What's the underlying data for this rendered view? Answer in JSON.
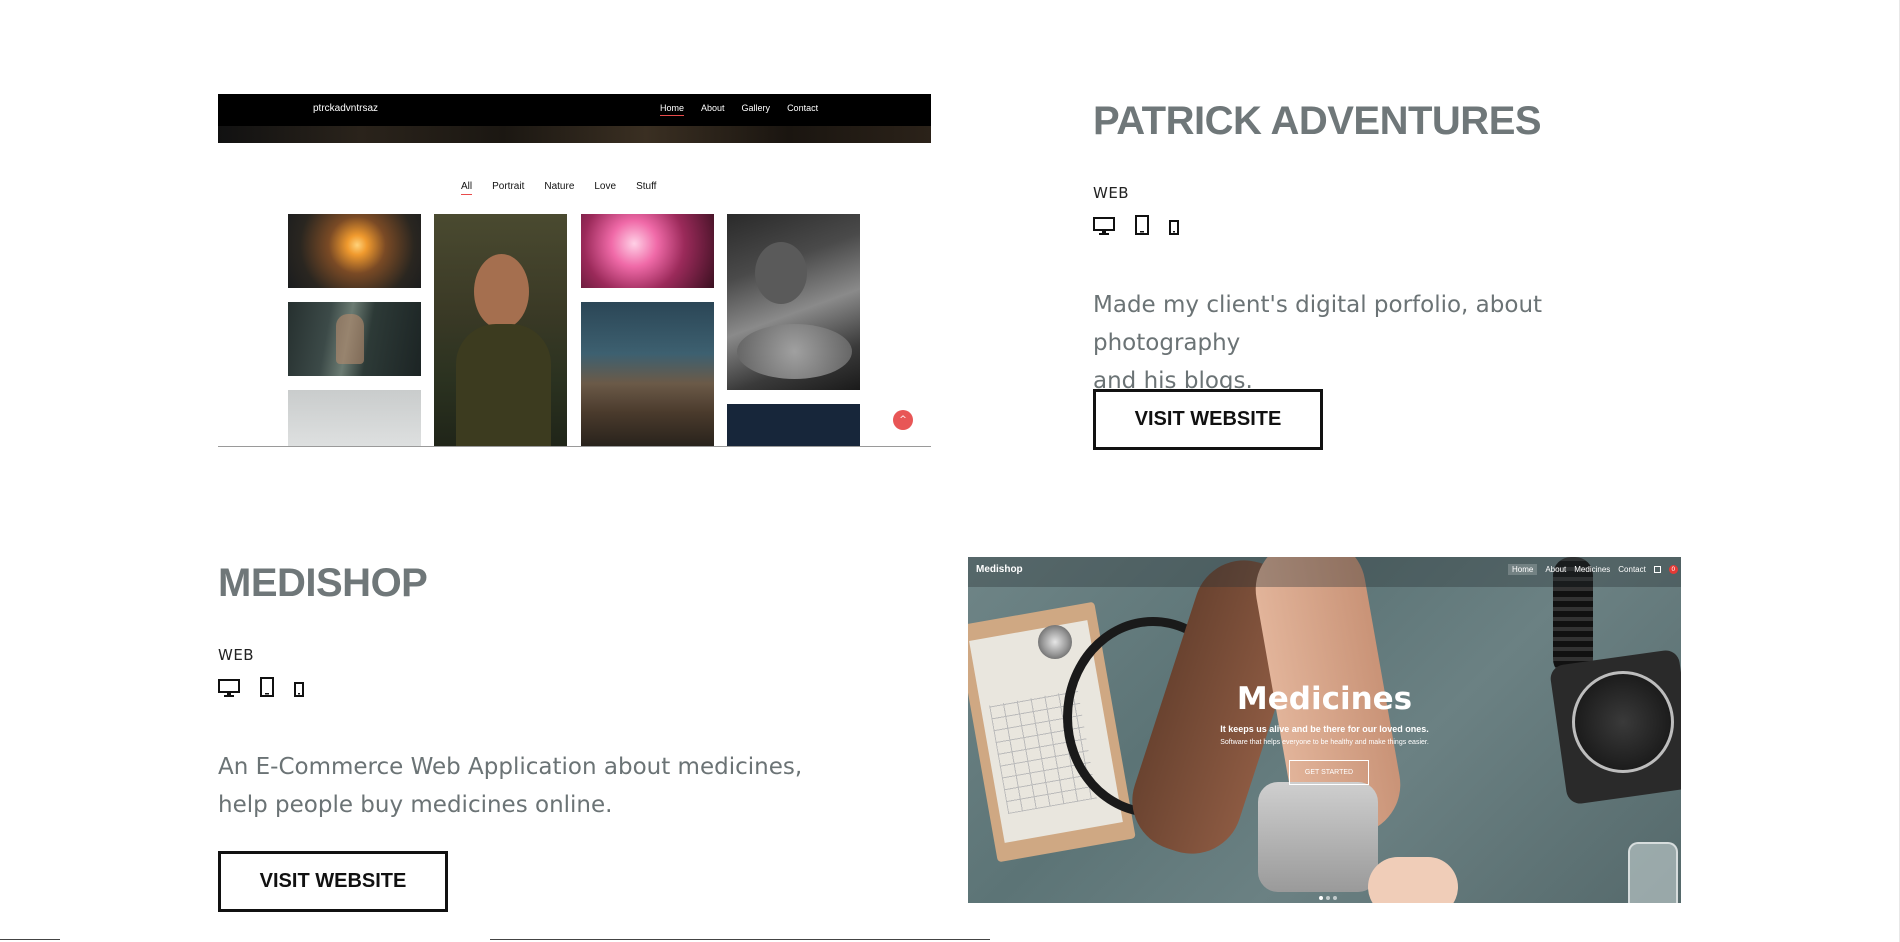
{
  "projects": [
    {
      "title": "PATRICK ADVENTURES",
      "category": "WEB",
      "description_line1": "Made my client's digital porfolio, about photography",
      "description_line2": "and his blogs.",
      "button_label": "VISIT WEBSITE",
      "devices": [
        "desktop-icon",
        "tablet-icon",
        "phone-icon"
      ]
    },
    {
      "title": "MEDISHOP",
      "category": "WEB",
      "description_line1": "An E-Commerce Web Application about medicines,",
      "description_line2": "help people buy medicines online.",
      "button_label": "VISIT WEBSITE",
      "devices": [
        "desktop-icon",
        "tablet-icon",
        "phone-icon"
      ]
    }
  ],
  "preview_patrick": {
    "brand": "ptrckadvntrsaz",
    "nav": [
      "Home",
      "About",
      "Gallery",
      "Contact"
    ],
    "active_nav": "Home",
    "filters": [
      "All",
      "Portrait",
      "Nature",
      "Love",
      "Stuff"
    ],
    "active_filter": "All",
    "back_to_top": "^"
  },
  "preview_medishop": {
    "brand": "Medishop",
    "nav": [
      "Home",
      "About",
      "Medicines",
      "Contact"
    ],
    "cart_badge": "0",
    "hero_title": "Medicines",
    "hero_subtitle": "It keeps us alive and be there for our loved ones.",
    "hero_tagline": "Software that helps everyone to be healthy and make things easier.",
    "cta_label": "GET STARTED"
  },
  "colors": {
    "title": "#6f7779",
    "text": "#6b7375",
    "button_border": "#111111",
    "accent": "#e84b4b"
  }
}
